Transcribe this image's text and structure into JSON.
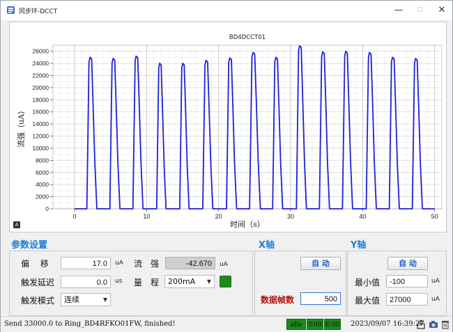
{
  "window": {
    "title": "同步环-DCCT",
    "minimize_glyph": "—",
    "maximize_glyph": "☐",
    "close_glyph": "✕"
  },
  "corner_badge": "A",
  "chart_data": {
    "type": "line",
    "title": "BD4DCCT01",
    "xlabel": "时间（s）",
    "ylabel": "流强（uA）",
    "xlim": [
      -3,
      51
    ],
    "ylim": [
      0,
      27000
    ],
    "x_ticks": [
      0,
      10,
      20,
      30,
      40,
      50
    ],
    "y_ticks": [
      0,
      2000,
      4000,
      6000,
      8000,
      10000,
      12000,
      14000,
      16000,
      18000,
      20000,
      22000,
      24000,
      26000
    ],
    "grid": true,
    "line_color": "#1f1fd8",
    "pulses": [
      {
        "start": 1.7,
        "end": 3.1,
        "peak": 25000
      },
      {
        "start": 4.9,
        "end": 6.3,
        "peak": 24800
      },
      {
        "start": 8.1,
        "end": 9.5,
        "peak": 25200
      },
      {
        "start": 11.4,
        "end": 12.7,
        "peak": 24000
      },
      {
        "start": 14.6,
        "end": 15.9,
        "peak": 24000
      },
      {
        "start": 17.8,
        "end": 19.2,
        "peak": 24500
      },
      {
        "start": 21.1,
        "end": 22.5,
        "peak": 24900
      },
      {
        "start": 24.3,
        "end": 25.8,
        "peak": 25800
      },
      {
        "start": 27.5,
        "end": 28.9,
        "peak": 25000
      },
      {
        "start": 30.8,
        "end": 32.2,
        "peak": 26900
      },
      {
        "start": 34.0,
        "end": 35.4,
        "peak": 25900
      },
      {
        "start": 37.2,
        "end": 38.6,
        "peak": 26000
      },
      {
        "start": 40.5,
        "end": 41.9,
        "peak": 25800
      },
      {
        "start": 43.7,
        "end": 45.1,
        "peak": 25000
      },
      {
        "start": 46.9,
        "end": 48.3,
        "peak": 24800
      }
    ]
  },
  "params": {
    "title": "参数设置",
    "offset_label": "偏　 移",
    "offset_value": "17.0",
    "offset_unit": "uA",
    "current_label": "流　强",
    "current_value": "-42.670",
    "current_unit": "uA",
    "delay_label": "触发延迟",
    "delay_value": "0.0",
    "delay_unit": "us",
    "range_label": "量　程",
    "range_value": "200mA",
    "range_arrow": "▼",
    "mode_label": "触发模式",
    "mode_value": "连续",
    "mode_arrow": "▼",
    "indicator_color": "#1d8a1d"
  },
  "x_axis": {
    "title": "X轴",
    "auto_label": "自 动",
    "frames_label": "数据帧数",
    "frames_value": "500"
  },
  "y_axis": {
    "title": "Y轴",
    "auto_label": "自 动",
    "min_label": "最小值",
    "min_value": "-100",
    "min_unit": "uA",
    "max_label": "最大值",
    "max_value": "27000",
    "max_unit": "uA"
  },
  "status": {
    "message": "Send 33000.0 to Ring_BD4RFKO01FW, finished!",
    "idle": "idle",
    "y_counter": "Y:00",
    "e_counter": "E:00",
    "datetime": "2023/09/07 16:39:27"
  },
  "colors": {
    "accent": "#1e7fd6",
    "status_green": "#1a8a1a",
    "plot_line": "#1f1fd8",
    "frames_label": "#b01010"
  }
}
